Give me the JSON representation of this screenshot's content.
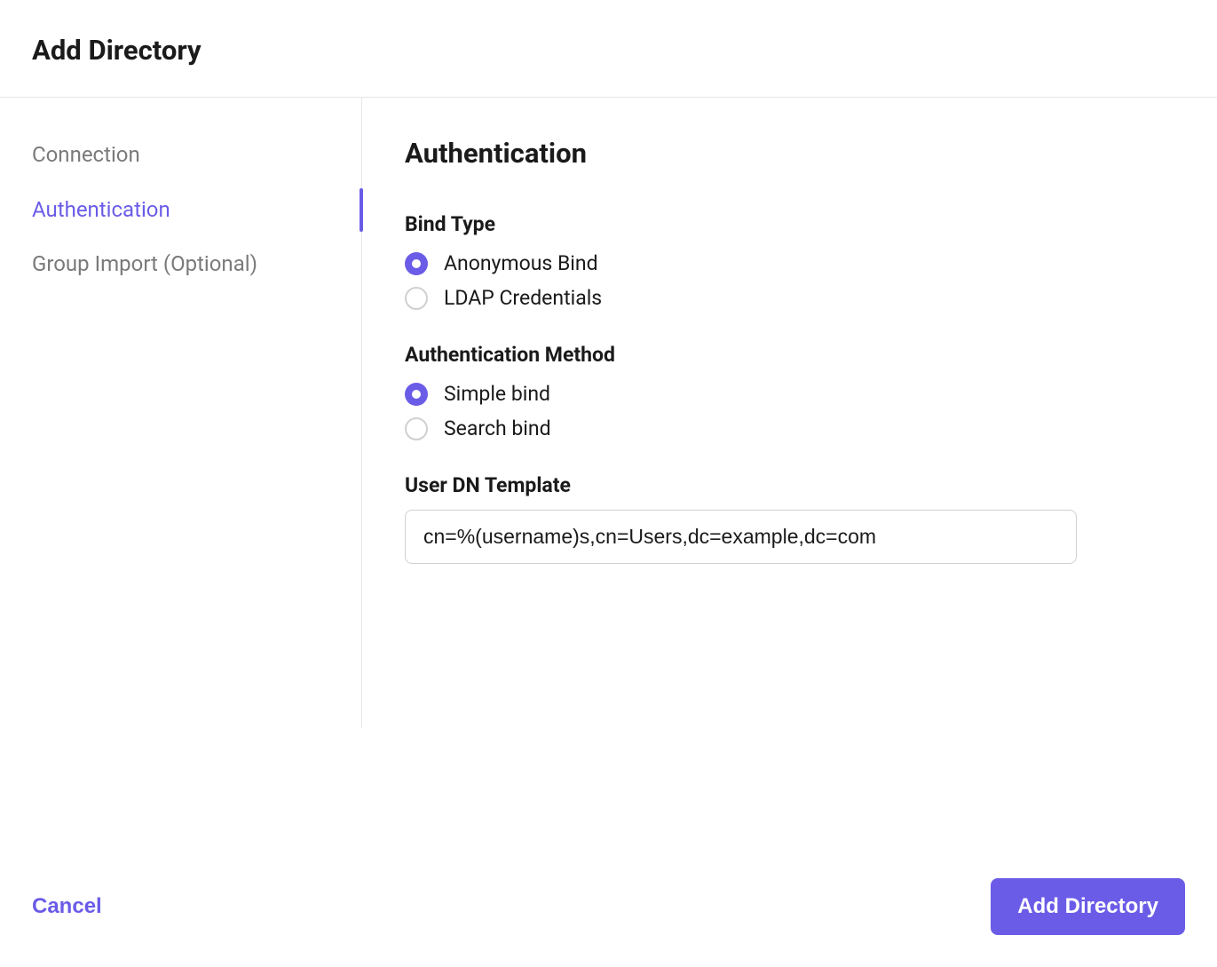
{
  "header": {
    "title": "Add Directory"
  },
  "sidebar": {
    "items": [
      {
        "label": "Connection",
        "active": false
      },
      {
        "label": "Authentication",
        "active": true
      },
      {
        "label": "Group Import (Optional)",
        "active": false
      }
    ]
  },
  "main": {
    "heading": "Authentication",
    "bind_type": {
      "label": "Bind Type",
      "options": [
        {
          "label": "Anonymous Bind",
          "selected": true
        },
        {
          "label": "LDAP Credentials",
          "selected": false
        }
      ]
    },
    "auth_method": {
      "label": "Authentication Method",
      "options": [
        {
          "label": "Simple bind",
          "selected": true
        },
        {
          "label": "Search bind",
          "selected": false
        }
      ]
    },
    "user_dn_template": {
      "label": "User DN Template",
      "value": "cn=%(username)s,cn=Users,dc=example,dc=com"
    }
  },
  "footer": {
    "cancel_label": "Cancel",
    "submit_label": "Add Directory"
  }
}
